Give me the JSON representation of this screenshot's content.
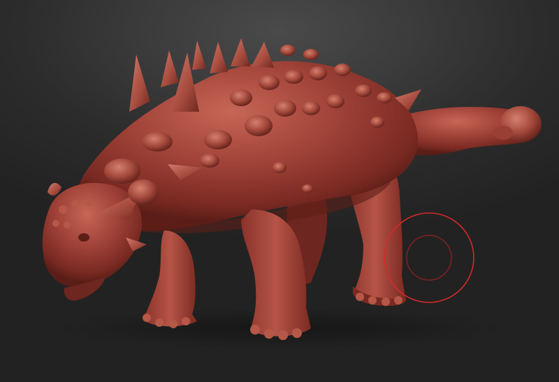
{
  "app": {
    "type": "3d-sculpt-viewport"
  },
  "model": {
    "subject": "ankylosaurus",
    "material_color": "#9b3a2f",
    "material_highlight": "#c9685a",
    "material_shadow": "#4a1510"
  },
  "brush": {
    "outer_color": "#d42a2a",
    "inner_color": "#8a2020"
  },
  "colors": {
    "background_top": "#4a4a4a",
    "background_bottom": "#222222"
  }
}
